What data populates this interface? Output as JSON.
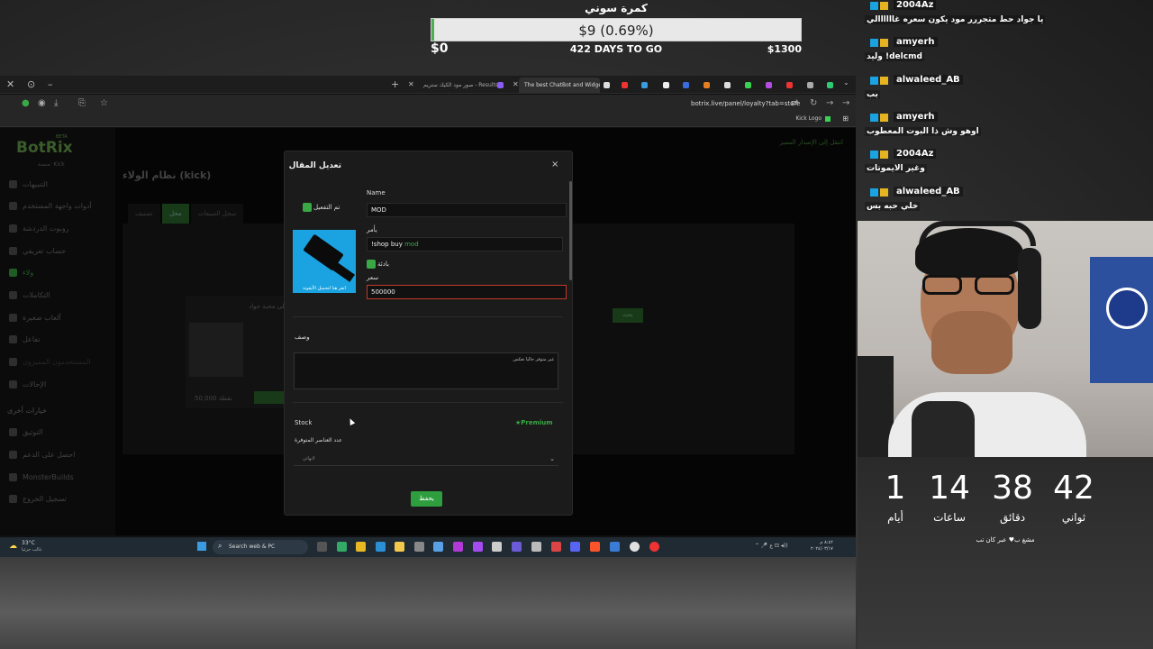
{
  "goal": {
    "title": "كمرة سوني",
    "bar_text": "$9 (0.69%)",
    "progress_pct": 0.69,
    "start": "$0",
    "days": "422 DAYS TO GO",
    "end": "$1300"
  },
  "browser": {
    "tabs": [
      {
        "label": "صور مود الكيك ستريم - Results"
      },
      {
        "label": "The best ChatBot and Widgets"
      }
    ],
    "url": "botrix.live/panel/loyalty?tab=store",
    "bookmark": "Kick Logo"
  },
  "sidebar": {
    "logo": "BotRix",
    "beta": "BETA",
    "sub": "منصة: Kick",
    "items": [
      {
        "label": "التنبيهات"
      },
      {
        "label": "أدوات واجهة المستخدم"
      },
      {
        "label": "روبوت الدردشة"
      },
      {
        "label": "حساب تعريفي"
      },
      {
        "label": "ولاء"
      },
      {
        "label": "التكاملات"
      },
      {
        "label": "ألعاب صغيرة"
      },
      {
        "label": "تفاعل"
      },
      {
        "label": "المستخدمون المميزون"
      },
      {
        "label": "الإحالات"
      }
    ],
    "section": "خيارات أخرى",
    "other": [
      {
        "label": "التوثيق"
      },
      {
        "label": "احصل على الدعم"
      },
      {
        "label": "MonsterBuilds"
      },
      {
        "label": "تسجيل الخروج"
      }
    ]
  },
  "page": {
    "title": "نظام الولاء (kick)",
    "upgrade": "انتقل إلى الإصدار المميز",
    "tabs": [
      {
        "label": "تصنيف"
      },
      {
        "label": "محل"
      },
      {
        "label": "سجل المبيعات"
      }
    ],
    "card_title": "على محبة جواد",
    "card_price": "50,000 نقطة",
    "panel_button": "بحث"
  },
  "modal": {
    "title": "تعديل المقال",
    "close": "×",
    "active_label": "تم التفعيل",
    "name_label": "Name",
    "name_value": "MOD",
    "command_label": "يأمر",
    "command_prefix": "!shop buy",
    "command_tag": "mod",
    "required_label": "بادئة",
    "price_label": "سعر",
    "price_value": "500000",
    "image_caption": "انقر هنا لتحميل الأيقونة",
    "desc_label": "وصف",
    "desc_value": "غير متوفر حاليا تعكس",
    "stock_label": "Stock",
    "premium": "Premium",
    "available_label": "عدد العناصر المتوفرة",
    "select_value": "لانهائي",
    "save": "يحفظ"
  },
  "taskbar": {
    "temp": "33°C",
    "weather": "غالب جزئيا",
    "search": "Search web & PC",
    "time": "٨:٤٢ م",
    "date": "٢٠٢٤/٠٣/١٧"
  },
  "chat": [
    {
      "user": "2004Az",
      "text": "يا جواد حط متجررر مود يكون سعره غاااااالي"
    },
    {
      "user": "amyerh",
      "text": "وليد !delcmd"
    },
    {
      "user": "alwaleed_AB",
      "text": "بب"
    },
    {
      "user": "amyerh",
      "text": "اوهو وش ذا البوت المعطوب"
    },
    {
      "user": "2004Az",
      "text": "وغير الايموتات"
    },
    {
      "user": "alwaleed_AB",
      "text": "خلي حبه بس"
    }
  ],
  "countdown": {
    "days": "1",
    "days_label": "أيام",
    "hours": "14",
    "hours_label": "ساعات",
    "minutes": "38",
    "minutes_label": "دقائق",
    "seconds": "42",
    "seconds_label": "ثواني",
    "note": "مشغ ب♥ عبر كان تب"
  },
  "colors": {
    "accent": "#39a845",
    "error": "#c0392b",
    "kick_blue": "#1aa3e0"
  }
}
